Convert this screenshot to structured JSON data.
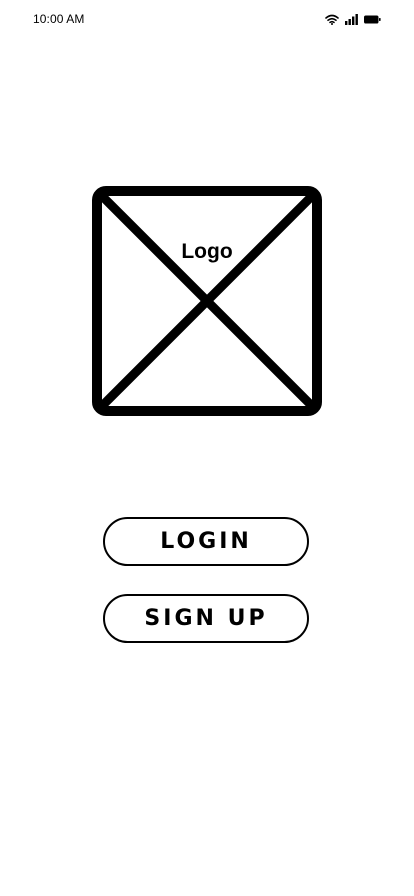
{
  "status_bar": {
    "time": "10:00 AM",
    "icons": [
      "wifi-icon",
      "cellular-signal-icon",
      "battery-icon"
    ]
  },
  "logo": {
    "label": "Logo"
  },
  "buttons": {
    "login": "LOGIN",
    "signup": "SIGN UP"
  },
  "colors": {
    "foreground": "#000000",
    "background": "#ffffff"
  }
}
